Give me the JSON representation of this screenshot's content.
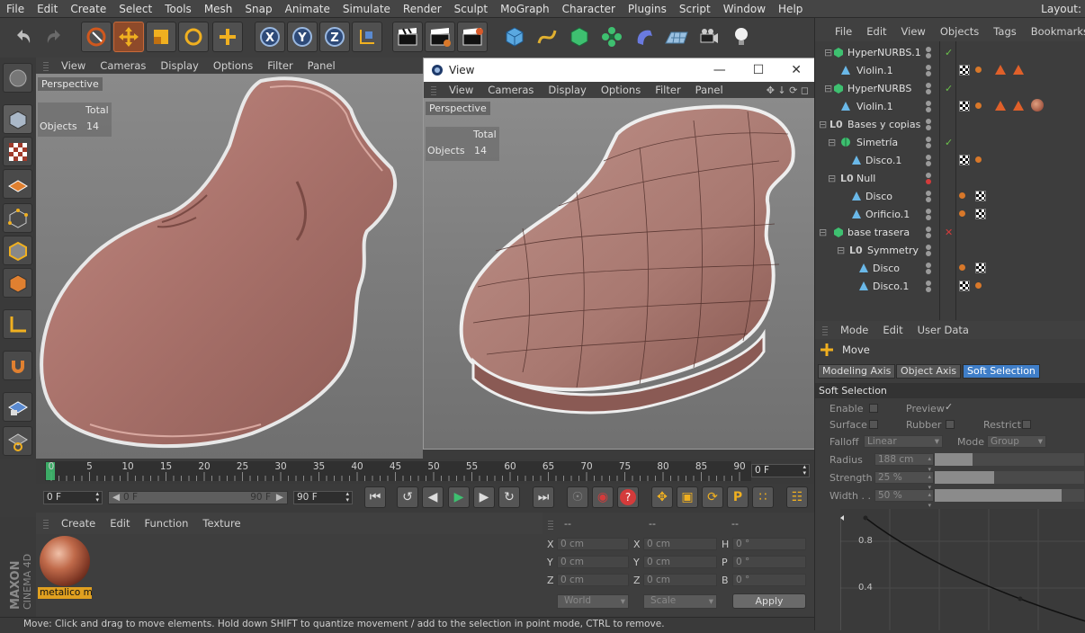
{
  "menubar": {
    "items": [
      "File",
      "Edit",
      "Create",
      "Select",
      "Tools",
      "Mesh",
      "Snap",
      "Animate",
      "Simulate",
      "Render",
      "Sculpt",
      "MoGraph",
      "Character",
      "Plugins",
      "Script",
      "Window",
      "Help"
    ],
    "layout_label": "Layout:"
  },
  "viewport1": {
    "menu": [
      "View",
      "Cameras",
      "Display",
      "Options",
      "Filter",
      "Panel"
    ],
    "camera_label": "Perspective",
    "stats_total": "Total",
    "stats_objects_label": "Objects",
    "stats_objects_value": "14"
  },
  "viewport2": {
    "window_title": "View",
    "menu": [
      "View",
      "Cameras",
      "Display",
      "Options",
      "Filter",
      "Panel"
    ],
    "camera_label": "Perspective",
    "stats_total": "Total",
    "stats_objects_label": "Objects",
    "stats_objects_value": "14"
  },
  "object_manager": {
    "menu": [
      "File",
      "Edit",
      "View",
      "Objects",
      "Tags",
      "Bookmarks"
    ],
    "rows": [
      {
        "name": "HyperNURBS.1"
      },
      {
        "name": "Violin.1"
      },
      {
        "name": "HyperNURBS"
      },
      {
        "name": "Violin.1"
      },
      {
        "name": "Bases y copias"
      },
      {
        "name": "Simetría"
      },
      {
        "name": "Disco.1"
      },
      {
        "name": "Null"
      },
      {
        "name": "Disco"
      },
      {
        "name": "Orificio.1"
      },
      {
        "name": "base trasera"
      },
      {
        "name": "Symmetry"
      },
      {
        "name": "Disco"
      },
      {
        "name": "Disco.1"
      }
    ]
  },
  "attributes": {
    "menu": [
      "Mode",
      "Edit",
      "User Data"
    ],
    "tool_name": "Move",
    "tabs": [
      "Modeling Axis",
      "Object Axis",
      "Soft Selection"
    ],
    "section_title": "Soft Selection",
    "enable_label": "Enable",
    "preview_label": "Preview",
    "surface_label": "Surface",
    "rubber_label": "Rubber",
    "restrict_label": "Restrict",
    "falloff_label": "Falloff",
    "falloff_value": "Linear",
    "mode_label": "Mode",
    "mode_value": "Group",
    "radius_label": "Radius",
    "radius_value": "188 cm",
    "radius_fill": 0.25,
    "strength_label": "Strength",
    "strength_value": "25 %",
    "strength_fill": 0.4,
    "width_label": "Width . .",
    "width_value": "50 %",
    "width_fill": 0.85,
    "graph_y_labels": [
      "0.8",
      "0.4"
    ]
  },
  "timeline": {
    "ticks": [
      "0",
      "5",
      "10",
      "15",
      "20",
      "25",
      "30",
      "35",
      "40",
      "45",
      "50",
      "55",
      "60",
      "65",
      "70",
      "75",
      "80",
      "85",
      "90"
    ],
    "current_frame": "0 F"
  },
  "transport": {
    "start_field": "0 F",
    "range_start": "0 F",
    "range_end": "90 F",
    "end_field": "90 F"
  },
  "material_manager": {
    "menu": [
      "Create",
      "Edit",
      "Function",
      "Texture"
    ],
    "material_name": "metalico m"
  },
  "coordinates": {
    "header": [
      "--",
      "--",
      "--"
    ],
    "rows": [
      {
        "a_label": "X",
        "a_value": "0 cm",
        "b_label": "X",
        "b_value": "0 cm",
        "c_label": "H",
        "c_value": "0 °"
      },
      {
        "a_label": "Y",
        "a_value": "0 cm",
        "b_label": "Y",
        "b_value": "0 cm",
        "c_label": "P",
        "c_value": "0 °"
      },
      {
        "a_label": "Z",
        "a_value": "0 cm",
        "b_label": "Z",
        "b_value": "0 cm",
        "c_label": "B",
        "c_value": "0 °"
      }
    ],
    "space_value": "World",
    "scale_value": "Scale",
    "apply_label": "Apply"
  },
  "status_text": "Move: Click and drag to move elements. Hold down SHIFT to quantize movement / add to the selection in point mode, CTRL to remove.",
  "brand": {
    "line1": "MAXON",
    "line2": "CINEMA 4D"
  },
  "colors": {
    "accent": "#4a90d0",
    "violin": "#b07a72",
    "active_tab": "#3f7ec8",
    "highlight": "#d8782a"
  }
}
